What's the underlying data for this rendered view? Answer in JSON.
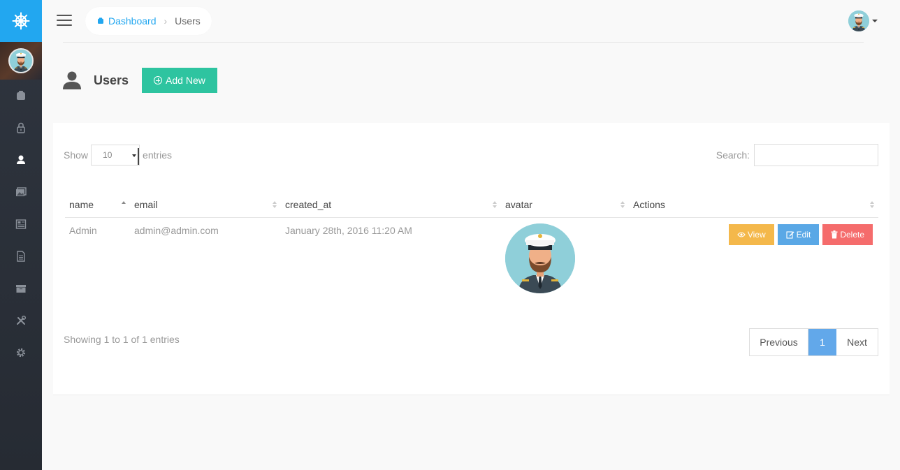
{
  "breadcrumb": {
    "home_label": "Dashboard",
    "current": "Users"
  },
  "sidebar": {
    "items": [
      {
        "icon": "dashboard-icon"
      },
      {
        "icon": "lock-icon"
      },
      {
        "icon": "user-icon",
        "active": true
      },
      {
        "icon": "image-icon"
      },
      {
        "icon": "news-icon"
      },
      {
        "icon": "document-icon"
      },
      {
        "icon": "folder-icon"
      },
      {
        "icon": "tools-icon"
      },
      {
        "icon": "gear-icon"
      }
    ]
  },
  "header": {
    "title": "Users",
    "add_button": "Add New"
  },
  "table_controls": {
    "show_label": "Show",
    "entries_label": "entries",
    "page_length": "10",
    "search_label": "Search:"
  },
  "table": {
    "columns": [
      "name",
      "email",
      "created_at",
      "avatar",
      "Actions"
    ],
    "rows": [
      {
        "name": "Admin",
        "email": "admin@admin.com",
        "created_at": "January 28th, 2016 11:20 AM"
      }
    ],
    "actions": {
      "view": "View",
      "edit": "Edit",
      "delete": "Delete"
    }
  },
  "footer": {
    "info": "Showing 1 to 1 of 1 entries",
    "previous": "Previous",
    "page": "1",
    "next": "Next"
  },
  "colors": {
    "brand": "#22a7f0",
    "add_button": "#2ec4a0",
    "view": "#f4b84b",
    "edit": "#5aa8e6",
    "delete": "#f56c6c",
    "active_page": "#62a8ea"
  }
}
